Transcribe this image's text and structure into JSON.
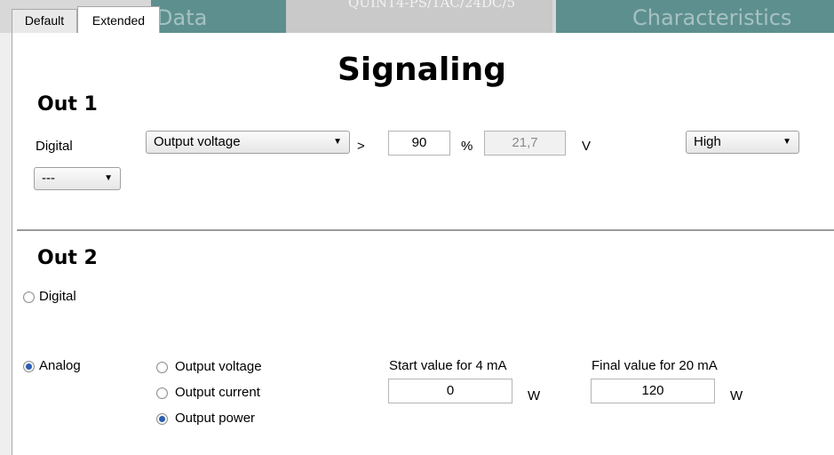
{
  "tabs": {
    "default": "Default",
    "extended": "Extended",
    "bg_data": "Data",
    "bg_model": "QUINT4-PS/1AC/24DC/5",
    "bg_characteristics": "Characteristics"
  },
  "title": "Signaling",
  "out1": {
    "title": "Out 1",
    "digital_label": "Digital",
    "signal_select": "Output voltage",
    "comparator": ">",
    "threshold_value": "90",
    "threshold_unit": "%",
    "computed_value": "21,7",
    "computed_unit": "V",
    "level_select": "High",
    "digital_select": "---"
  },
  "out2": {
    "title": "Out 2",
    "digital_label": "Digital",
    "analog_label": "Analog",
    "options": [
      "Output voltage",
      "Output current",
      "Output power"
    ],
    "start_label": "Start value for 4 mA",
    "start_value": "0",
    "start_unit": "W",
    "final_label": "Final value for 20 mA",
    "final_value": "120",
    "final_unit": "W"
  }
}
